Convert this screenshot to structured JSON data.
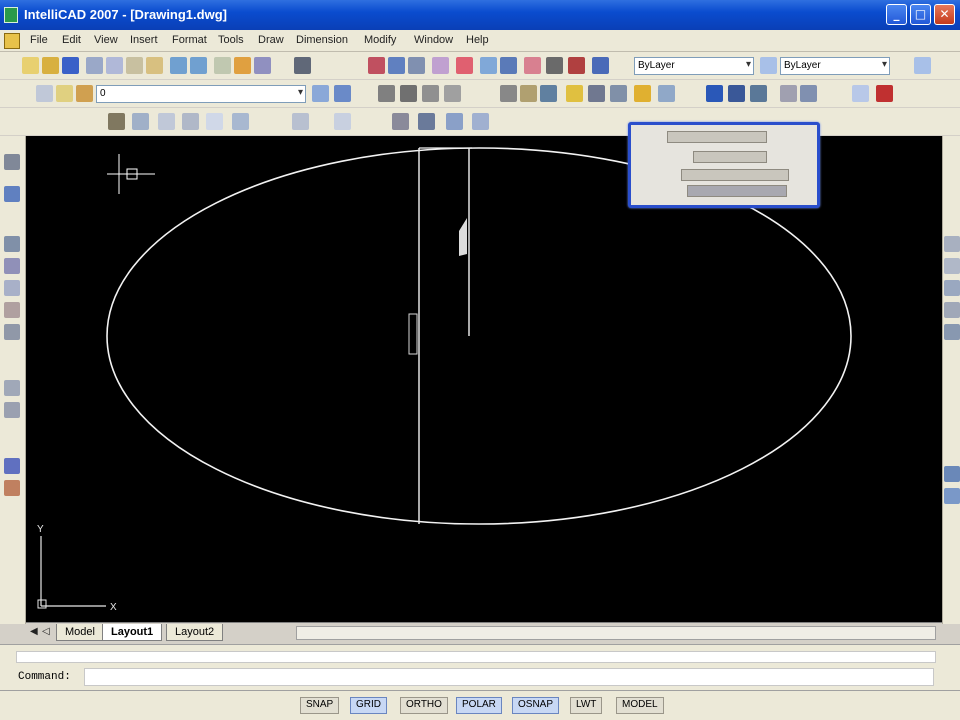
{
  "window": {
    "title": "IntelliCAD 2007 - [Drawing1.dwg]",
    "controls": {
      "minimize": "_",
      "maximize": "□",
      "close": "✕"
    }
  },
  "menubar": {
    "items": [
      "File",
      "Edit",
      "View",
      "Insert",
      "Format",
      "Tools",
      "Draw",
      "Dimension",
      "Modify",
      "Window",
      "Help"
    ]
  },
  "toolbars": {
    "standard_icons": [
      "new-icon",
      "open-icon",
      "save-icon",
      "print-icon",
      "cut-icon",
      "copy-icon",
      "paste-icon",
      "undo-icon",
      "redo-icon",
      "pan-icon",
      "zoom-icon",
      "properties-icon"
    ],
    "layer_combo": "0",
    "color_combo": "ByLayer",
    "linetype_combo": "ByLayer",
    "draw_icons": [
      "line-icon",
      "polyline-icon",
      "circle-icon",
      "arc-icon",
      "ellipse-icon",
      "rectangle-icon",
      "hatch-icon",
      "text-icon"
    ],
    "modify_icons": [
      "move-icon",
      "rotate-icon",
      "scale-icon",
      "mirror-icon",
      "offset-icon",
      "trim-icon",
      "extend-icon",
      "fillet-icon",
      "chamfer-icon",
      "erase-icon"
    ]
  },
  "drawing": {
    "background": "#000000",
    "entity_color": "#ffffff",
    "ucs_x": "X",
    "ucs_y": "Y"
  },
  "layout_tabs": [
    "Model",
    "Layout1",
    "Layout2"
  ],
  "active_tab": "Model",
  "command": {
    "prompt": "Command:",
    "value": ""
  },
  "statusbar": {
    "coords": "",
    "buttons": [
      "SNAP",
      "GRID",
      "ORTHO",
      "POLAR",
      "OSNAP",
      "LWT",
      "MODEL"
    ]
  },
  "colors": {
    "titlebar": "#0a4ccf",
    "chrome": "#ece9d8",
    "canvas": "#000000",
    "dialog_border": "#2a4ecc"
  }
}
